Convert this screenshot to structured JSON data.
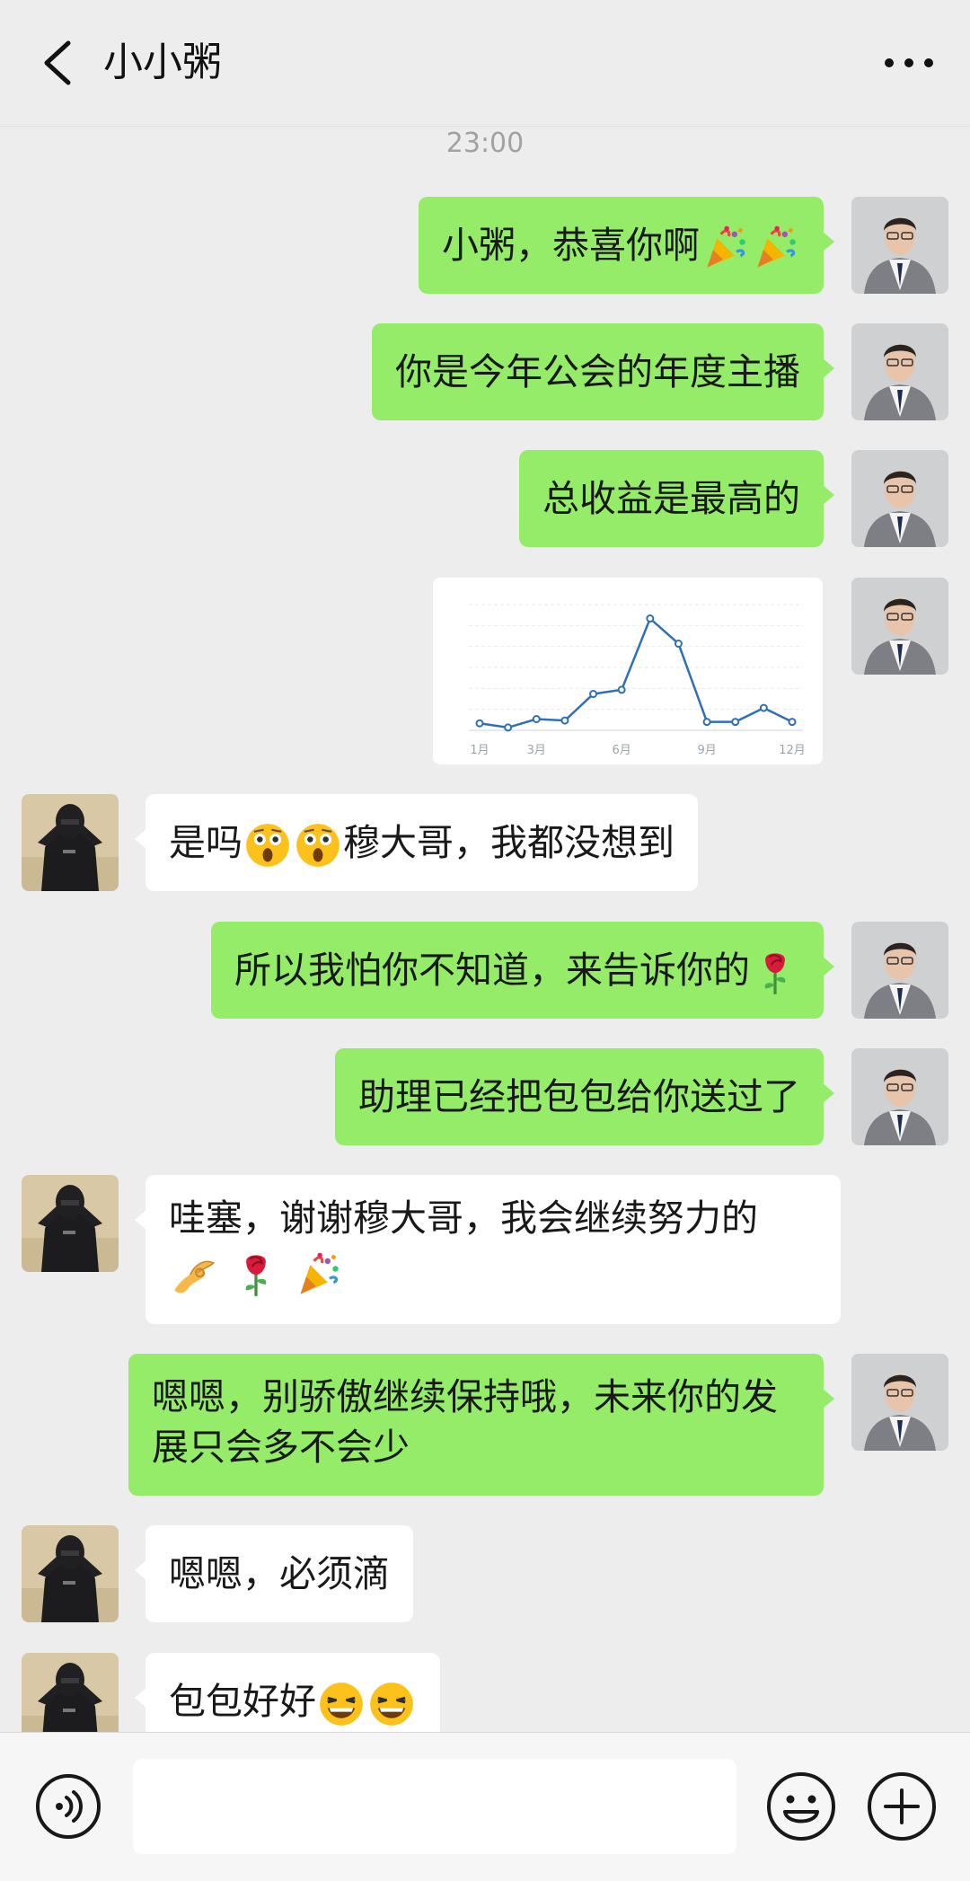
{
  "header": {
    "title": "小小粥",
    "back_icon": "chevron-left-icon",
    "more_icon": "more-dots-icon"
  },
  "timestamp": "23:00",
  "messages": [
    {
      "from": "me",
      "parts": [
        "小粥，恭喜你啊"
      ],
      "emojis": [
        "party-popper-icon",
        "party-popper-icon"
      ]
    },
    {
      "from": "me",
      "parts": [
        "你是今年公会的年度主播"
      ]
    },
    {
      "from": "me",
      "parts": [
        "总收益是最高的"
      ]
    },
    {
      "from": "me",
      "type": "image",
      "content": "earnings-chart"
    },
    {
      "from": "other",
      "parts": [
        "是吗",
        "穆大哥，我都没想到"
      ],
      "emojis": [
        "astonished-face-icon",
        "astonished-face-icon"
      ]
    },
    {
      "from": "me",
      "parts": [
        "所以我怕你不知道，来告诉你的"
      ],
      "emojis": [
        "rose-icon"
      ]
    },
    {
      "from": "me",
      "parts": [
        "助理已经把包包给你送过了"
      ]
    },
    {
      "from": "other",
      "parts": [
        "哇塞，谢谢穆大哥，我会继续努力的"
      ],
      "emojis": [
        "ok-hand-icon",
        "rose-icon",
        "party-popper-icon"
      ]
    },
    {
      "from": "me",
      "parts": [
        "嗯嗯，别骄傲继续保持哦，未来你的发展只会多不会少"
      ]
    },
    {
      "from": "other",
      "parts": [
        "嗯嗯，必须滴"
      ]
    },
    {
      "from": "other",
      "parts": [
        "包包好好"
      ],
      "emojis": [
        "grinning-squinting-face-icon",
        "grinning-squinting-face-icon"
      ]
    }
  ],
  "chart_data": {
    "type": "line",
    "x_tick_labels": [
      "1月",
      "3月",
      "6月",
      "9月",
      "12月"
    ],
    "x": [
      1,
      2,
      3,
      4,
      5,
      6,
      7,
      8,
      9,
      10,
      11,
      12
    ],
    "values": [
      5,
      2,
      8,
      7,
      26,
      29,
      80,
      62,
      6,
      6,
      16,
      6
    ],
    "ylim": [
      0,
      90
    ],
    "grid": true,
    "color": "#2f6fb8"
  },
  "input": {
    "value": "",
    "placeholder": ""
  },
  "icons": {
    "voice": "voice-icon",
    "emoji": "emoji-face-icon",
    "plus": "plus-circle-icon"
  },
  "colors": {
    "sent_bubble": "#95ec69",
    "received_bubble": "#ffffff",
    "background": "#ededed"
  }
}
